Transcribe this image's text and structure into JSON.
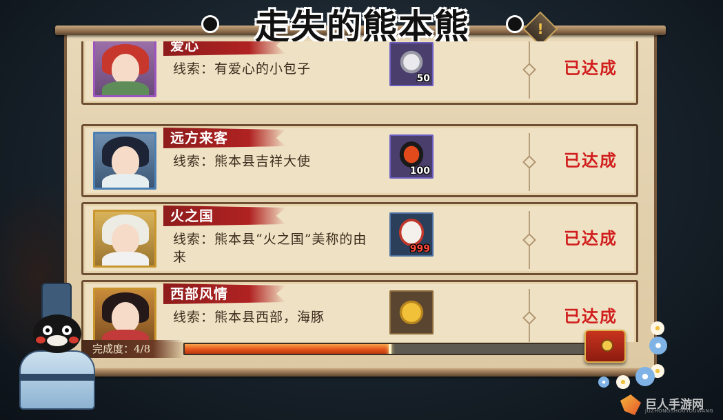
{
  "title": "走失的熊本熊",
  "info_button": "!",
  "tasks": [
    {
      "name": "爱心",
      "clue": "线索：有爱心的小包子",
      "reward_icon": "silver-coin-icon",
      "reward_count": "50",
      "status": "已达成"
    },
    {
      "name": "远方来客",
      "clue": "线索：熊本县吉祥大使",
      "reward_icon": "sushi-icon",
      "reward_count": "100",
      "status": "已达成"
    },
    {
      "name": "火之国",
      "clue": "线索：熊本县“火之国”美称的由来",
      "reward_icon": "daruma-material-icon",
      "reward_count": "999",
      "status": "已达成"
    },
    {
      "name": "西部风情",
      "clue": "线索：熊本县西部，海豚",
      "reward_icon": "gold-daruma-icon",
      "reward_count": "",
      "status": "已达成"
    }
  ],
  "progress": {
    "label": "完成度：4/8",
    "fraction": 0.5
  },
  "watermark": {
    "text": "巨人手游网",
    "sub": "JUZHONGSHOUYOUWANG"
  },
  "colors": {
    "status_red": "#d11d1d",
    "banner_red": "#b02222",
    "paper": "#efe2c4",
    "frame_brown": "#6e4f33",
    "progress_orange": "#e4541b"
  }
}
